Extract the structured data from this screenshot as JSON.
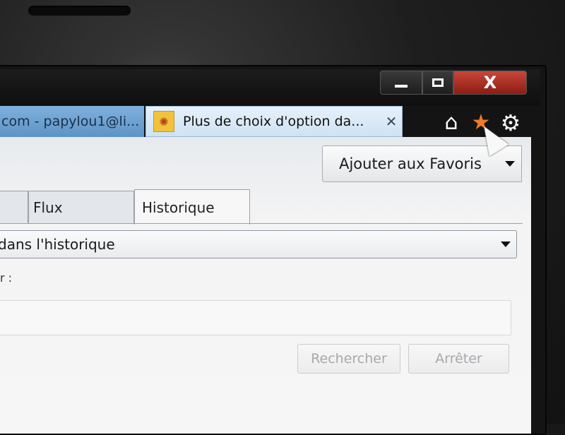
{
  "window_controls": {
    "minimize_icon": "minimize-icon",
    "maximize_icon": "restore-icon",
    "close_symbol": "X"
  },
  "tabs": [
    {
      "title": "com - papylou1@li..."
    },
    {
      "title": "Plus de choix d'option da...",
      "close_symbol": "✕",
      "favicon": "sun-favicon"
    }
  ],
  "toolbar": {
    "home_symbol": "⌂",
    "favorites_symbol": "★",
    "settings_symbol": "⚙"
  },
  "favorites_center": {
    "add_button_label": "Ajouter aux Favoris",
    "panel_tabs": [
      "",
      "Flux",
      "Historique"
    ],
    "history_filter": "dans l'historique",
    "search_label": "r :",
    "search_value": "",
    "search_button": "Rechercher",
    "stop_button": "Arrêter"
  },
  "colors": {
    "active_tab": "#dceaf7",
    "inactive_tab": "#6ea2d2",
    "close_button": "#b0382b",
    "favorites_star": "#f07b2a"
  }
}
